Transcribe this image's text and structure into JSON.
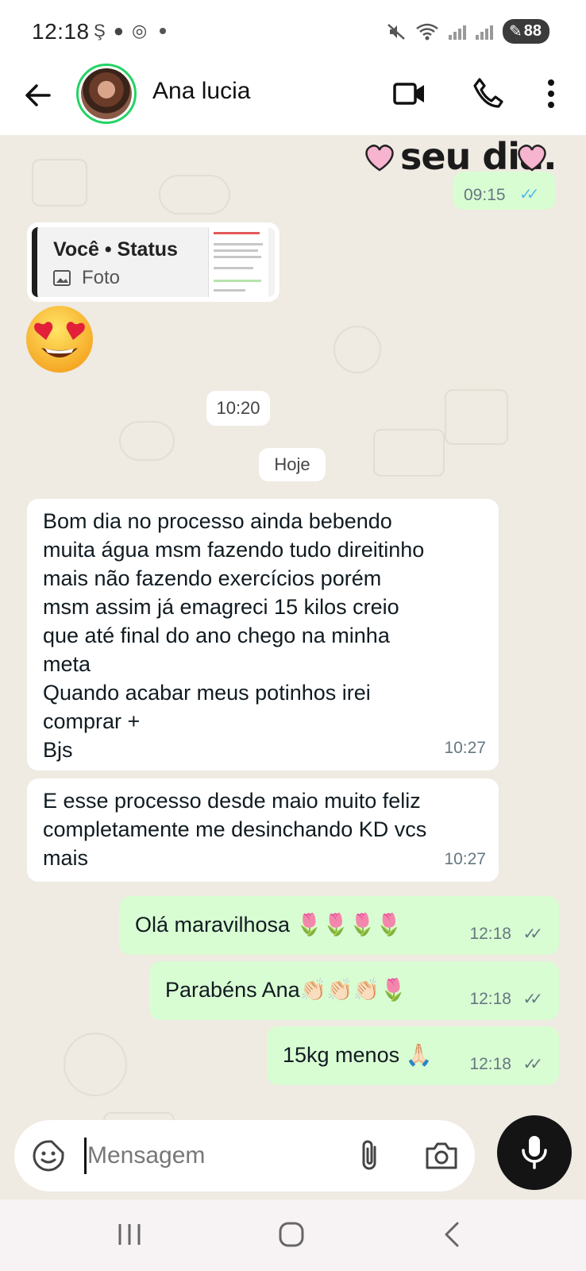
{
  "status_bar": {
    "time": "12:18",
    "battery": "88"
  },
  "header": {
    "contact_name": "Ana lucia",
    "icons": [
      "back-arrow-icon",
      "video-call-icon",
      "phone-icon",
      "more-vert-icon"
    ]
  },
  "chat": {
    "sticker_text": "seu dia.",
    "sticker_time": "09:15",
    "reply": {
      "author": "Você • Status",
      "type": "Foto"
    },
    "time_pill": "10:20",
    "date_pill": "Hoje",
    "incoming": [
      {
        "lines": [
          "Bom dia no processo ainda bebendo",
          "muita água msm fazendo tudo direitinho",
          "mais não fazendo exercícios porém",
          "msm assim já emagreci 15 kilos creio",
          "que até final do ano chego na minha",
          "meta",
          "Quando acabar meus potinhos irei",
          "comprar +",
          "Bjs"
        ],
        "time": "10:27"
      },
      {
        "lines": [
          "E esse processo desde maio muito feliz",
          "completamente me desinchando KD vcs",
          "mais"
        ],
        "time": "10:27"
      }
    ],
    "outgoing": [
      {
        "text": "Olá maravilhosa 🌷🌷🌷🌷",
        "time": "12:18"
      },
      {
        "text": "Parabéns Ana👏🏻👏🏻👏🏻🌷",
        "time": "12:18"
      },
      {
        "text": "15kg menos 🙏🏻",
        "time": "12:18"
      }
    ]
  },
  "composer": {
    "placeholder": "Mensagem"
  },
  "colors": {
    "chat_bg": "#efeae2",
    "outgoing_bubble": "#d9fdd3",
    "incoming_bubble": "#ffffff",
    "read_ticks": "#53bdeb",
    "avatar_ring": "#25d366"
  }
}
